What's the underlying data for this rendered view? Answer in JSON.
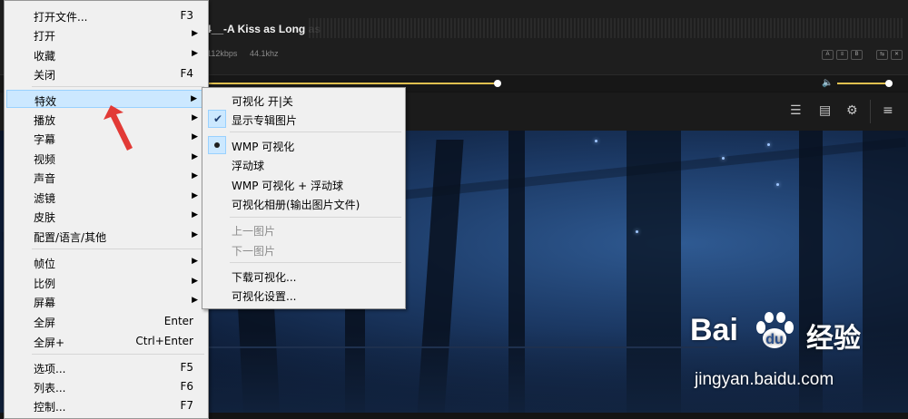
{
  "player": {
    "track_title": "4__-A Kiss as Long as",
    "bitrate": "112kbps",
    "samplerate": "44.1khz",
    "small_buttons": [
      "A",
      "≡",
      "B",
      "⇆",
      "✕"
    ],
    "colors": {
      "accent": "#e0c050",
      "background": "#141414"
    }
  },
  "main_menu": {
    "items": [
      {
        "label": "打开文件...",
        "shortcut": "F3"
      },
      {
        "label": "打开",
        "submenu": true
      },
      {
        "label": "收藏",
        "submenu": true
      },
      {
        "label": "关闭",
        "shortcut": "F4"
      },
      {
        "label": "特效",
        "submenu": true,
        "highlighted": true
      },
      {
        "label": "播放",
        "submenu": true
      },
      {
        "label": "字幕",
        "submenu": true
      },
      {
        "label": "视频",
        "submenu": true
      },
      {
        "label": "声音",
        "submenu": true
      },
      {
        "label": "滤镜",
        "submenu": true
      },
      {
        "label": "皮肤",
        "submenu": true
      },
      {
        "label": "配置/语言/其他",
        "submenu": true
      },
      {
        "label": "帧位",
        "submenu": true
      },
      {
        "label": "比例",
        "submenu": true
      },
      {
        "label": "屏幕",
        "submenu": true
      },
      {
        "label": "全屏",
        "shortcut": "Enter"
      },
      {
        "label": "全屏+",
        "shortcut": "Ctrl+Enter"
      },
      {
        "label": "选项...",
        "shortcut": "F5"
      },
      {
        "label": "列表...",
        "shortcut": "F6"
      },
      {
        "label": "控制...",
        "shortcut": "F7"
      }
    ],
    "arrow_glyph": "▶"
  },
  "effects_submenu": {
    "items": [
      {
        "label": "可视化 开|关"
      },
      {
        "label": "显示专辑图片",
        "checked": true
      },
      {
        "label": "WMP 可视化",
        "radio": true
      },
      {
        "label": "浮动球"
      },
      {
        "label": "WMP 可视化 + 浮动球"
      },
      {
        "label": "可视化相册(输出图片文件)"
      },
      {
        "label": "上一图片",
        "disabled": true
      },
      {
        "label": "下一图片",
        "disabled": true
      },
      {
        "label": "下载可视化..."
      },
      {
        "label": "可视化设置..."
      }
    ],
    "check_glyph": "✔"
  },
  "watermark": {
    "brand": "Bai",
    "brand_suffix": "经验",
    "url": "jingyan.baidu.com"
  }
}
